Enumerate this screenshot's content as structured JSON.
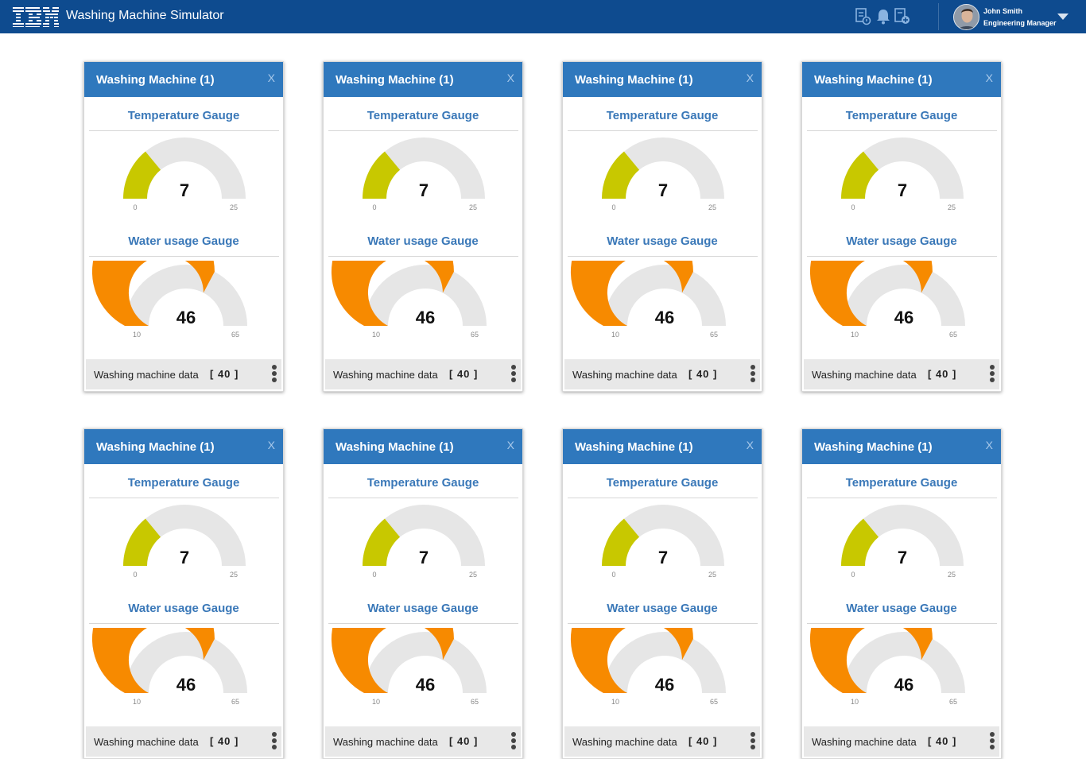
{
  "header": {
    "brand": "IBM",
    "title": "Washing Machine Simulator",
    "icons": [
      "reports-icon",
      "bell-icon",
      "add-document-icon"
    ],
    "user": {
      "name": "John Smith",
      "role": "Engineering Manager"
    }
  },
  "colors": {
    "header": "#0e4b8f",
    "card_head": "#2f78bd",
    "temperature": "#c8c800",
    "water": "#f78a00",
    "track": "#e6e6e6"
  },
  "cards": [
    {
      "title": "Washing Machine (1)",
      "close": "X",
      "temperature": {
        "label": "Temperature Gauge",
        "value": 7,
        "min": 0,
        "max": 25
      },
      "water": {
        "label": "Water usage Gauge",
        "value": 46,
        "min": 10,
        "max": 65
      },
      "footer": {
        "label": "Washing machine data",
        "value": "[ 40 ]"
      }
    },
    {
      "title": "Washing Machine (1)",
      "close": "X",
      "temperature": {
        "label": "Temperature Gauge",
        "value": 7,
        "min": 0,
        "max": 25
      },
      "water": {
        "label": "Water usage Gauge",
        "value": 46,
        "min": 10,
        "max": 65
      },
      "footer": {
        "label": "Washing machine data",
        "value": "[ 40 ]"
      }
    },
    {
      "title": "Washing Machine (1)",
      "close": "X",
      "temperature": {
        "label": "Temperature Gauge",
        "value": 7,
        "min": 0,
        "max": 25
      },
      "water": {
        "label": "Water usage Gauge",
        "value": 46,
        "min": 10,
        "max": 65
      },
      "footer": {
        "label": "Washing machine data",
        "value": "[ 40 ]"
      }
    },
    {
      "title": "Washing Machine (1)",
      "close": "X",
      "temperature": {
        "label": "Temperature Gauge",
        "value": 7,
        "min": 0,
        "max": 25
      },
      "water": {
        "label": "Water usage Gauge",
        "value": 46,
        "min": 10,
        "max": 65
      },
      "footer": {
        "label": "Washing machine data",
        "value": "[ 40 ]"
      }
    },
    {
      "title": "Washing Machine (1)",
      "close": "X",
      "temperature": {
        "label": "Temperature Gauge",
        "value": 7,
        "min": 0,
        "max": 25
      },
      "water": {
        "label": "Water usage Gauge",
        "value": 46,
        "min": 10,
        "max": 65
      },
      "footer": {
        "label": "Washing machine data",
        "value": "[ 40 ]"
      }
    },
    {
      "title": "Washing Machine (1)",
      "close": "X",
      "temperature": {
        "label": "Temperature Gauge",
        "value": 7,
        "min": 0,
        "max": 25
      },
      "water": {
        "label": "Water usage Gauge",
        "value": 46,
        "min": 10,
        "max": 65
      },
      "footer": {
        "label": "Washing machine data",
        "value": "[ 40 ]"
      }
    },
    {
      "title": "Washing Machine (1)",
      "close": "X",
      "temperature": {
        "label": "Temperature Gauge",
        "value": 7,
        "min": 0,
        "max": 25
      },
      "water": {
        "label": "Water usage Gauge",
        "value": 46,
        "min": 10,
        "max": 65
      },
      "footer": {
        "label": "Washing machine data",
        "value": "[ 40 ]"
      }
    },
    {
      "title": "Washing Machine (1)",
      "close": "X",
      "temperature": {
        "label": "Temperature Gauge",
        "value": 7,
        "min": 0,
        "max": 25
      },
      "water": {
        "label": "Water usage Gauge",
        "value": 46,
        "min": 10,
        "max": 65
      },
      "footer": {
        "label": "Washing machine data",
        "value": "[ 40 ]"
      }
    }
  ]
}
